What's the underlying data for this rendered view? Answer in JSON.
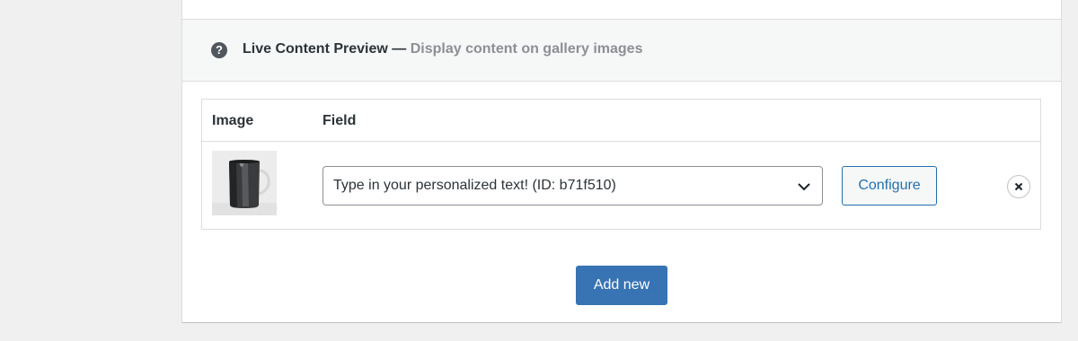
{
  "section": {
    "help_icon": "question-mark-icon",
    "title": "Live Content Preview",
    "separator": "—",
    "description": "Display content on gallery images"
  },
  "table": {
    "headers": [
      "Image",
      "Field"
    ],
    "rows": [
      {
        "image": "mug-thumbnail",
        "field_value": "Type in your personalized text! (ID: b71f510)",
        "configure_label": "Configure"
      }
    ]
  },
  "actions": {
    "add_new_label": "Add new"
  },
  "colors": {
    "accent": "#2271b1",
    "add_button_bg": "#3873b3",
    "header_bg": "#f6f7f7"
  }
}
